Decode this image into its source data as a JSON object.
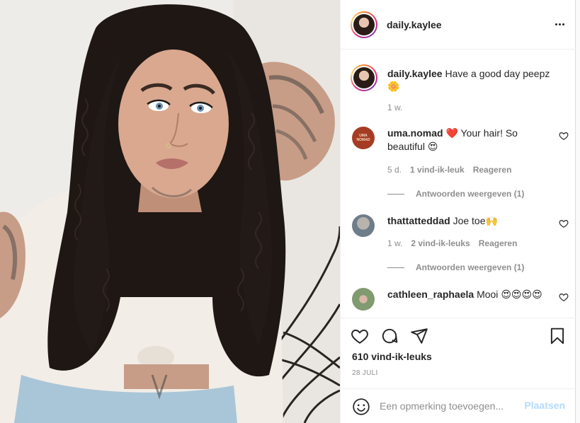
{
  "post": {
    "author": "daily.kaylee",
    "photo_alt": "Selfie with curly hair"
  },
  "header": {
    "username": "daily.kaylee",
    "more_icon": "more-horizontal-icon"
  },
  "caption": {
    "username": "daily.kaylee",
    "text": "Have a good day peepz",
    "emoji": "🌼",
    "time": "1 w."
  },
  "comments": [
    {
      "username": "uma.nomad",
      "text_before": "❤️",
      "text": "Your hair! So beautiful",
      "emoji": "😍",
      "time": "5 d.",
      "likes": "1 vind-ik-leuk",
      "reply": "Reageren",
      "view_replies": "Antwoorden weergeven (1)",
      "avatar_label": "UMA NOMAD"
    },
    {
      "username": "thattatteddad",
      "text": "Joe toe",
      "emoji": "🙌",
      "time": "1 w.",
      "likes": "2 vind-ik-leuks",
      "reply": "Reageren",
      "view_replies": "Antwoorden weergeven (1)"
    },
    {
      "username": "cathleen_raphaela",
      "text": "Mooi",
      "emoji": "😍😍😍😍"
    }
  ],
  "actions": {
    "like_icon": "heart-icon",
    "comment_icon": "comment-icon",
    "share_icon": "share-icon",
    "save_icon": "bookmark-icon"
  },
  "likes_count": "610 vind-ik-leuks",
  "date": "28 JULI",
  "add_comment": {
    "placeholder": "Een opmerking toevoegen...",
    "post_label": "Plaatsen",
    "post_color": "#b3dbff"
  }
}
